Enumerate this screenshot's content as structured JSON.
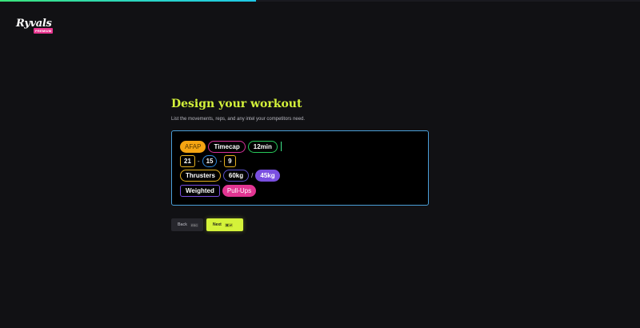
{
  "progress": 0.4,
  "brand": {
    "name": "Ryvals",
    "badge": "PREMIUM"
  },
  "heading": "Design your workout",
  "subtitle": "List the movements, reps, and any intel your competitors need.",
  "tokens": {
    "afap": "AFAP",
    "timecap": "Timecap",
    "time": "12min",
    "rep1": "21",
    "rep2": "15",
    "rep3": "9",
    "thrusters": "Thrusters",
    "weight1": "60kg",
    "weight2": "45kg",
    "weighted": "Weighted",
    "pullups": "Pull-Ups",
    "dash": "-",
    "slash": "/"
  },
  "buttons": {
    "back": "Back",
    "back_kbd": "ESC",
    "next": "Next",
    "next_kbd": "⌘ ↵"
  },
  "colors": {
    "accent": "#d4f23a",
    "editor_border": "#4a9fd8",
    "afap": "#f5a512",
    "timecap": "#d6339a",
    "time": "#27c95a",
    "reps": "#e5b020",
    "rep_mid": "#2f86d6",
    "thrusters": "#e5b020",
    "weight1_border": "#5a4fc9",
    "weight2_fill": "#7a4fe0",
    "weighted": "#7a4fe0",
    "pullups": "#e23592"
  }
}
